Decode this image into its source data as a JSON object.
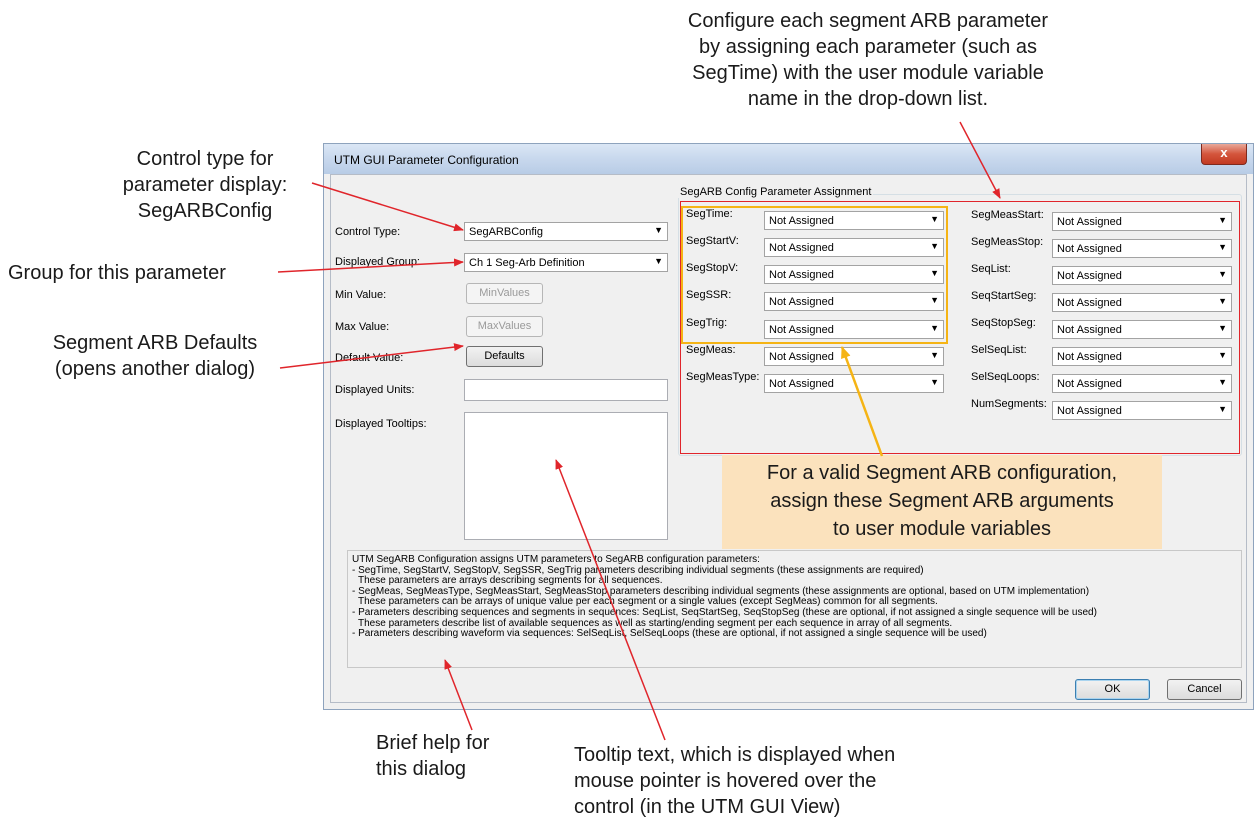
{
  "annotations": {
    "top_right": [
      "Configure each segment ARB parameter",
      "by assigning each parameter (such as",
      "SegTime) with the user module variable",
      "name in the drop-down list."
    ],
    "control_type": [
      "Control type for",
      "parameter display:",
      "SegARBConfig"
    ],
    "group": "Group for this parameter",
    "defaults": [
      "Segment ARB Defaults",
      "(opens another dialog)"
    ],
    "callout": [
      "For a valid Segment ARB configuration,",
      "assign these Segment ARB arguments",
      "to user module variables"
    ],
    "brief_help": [
      "Brief help for",
      "this dialog"
    ],
    "tooltip": [
      "Tooltip text, which is displayed when",
      "mouse pointer is hovered over the",
      "control (in the UTM GUI View)"
    ]
  },
  "dialog": {
    "title": "UTM GUI Parameter Configuration",
    "close_label": "x",
    "left": {
      "control_type_label": "Control Type:",
      "control_type_value": "SegARBConfig",
      "displayed_group_label": "Displayed Group:",
      "displayed_group_value": "Ch 1 Seg-Arb Definition",
      "min_value_label": "Min Value:",
      "min_value_button": "MinValues",
      "max_value_label": "Max Value:",
      "max_value_button": "MaxValues",
      "default_value_label": "Default Value:",
      "default_value_button": "Defaults",
      "displayed_units_label": "Displayed Units:",
      "displayed_tooltips_label": "Displayed Tooltips:"
    },
    "segarb": {
      "group_title": "SegARB Config Parameter Assignment",
      "left_col": [
        {
          "label": "SegTime:",
          "value": "Not Assigned"
        },
        {
          "label": "SegStartV:",
          "value": "Not Assigned"
        },
        {
          "label": "SegStopV:",
          "value": "Not Assigned"
        },
        {
          "label": "SegSSR:",
          "value": "Not Assigned"
        },
        {
          "label": "SegTrig:",
          "value": "Not Assigned"
        },
        {
          "label": "SegMeas:",
          "value": "Not Assigned"
        },
        {
          "label": "SegMeasType:",
          "value": "Not Assigned"
        }
      ],
      "right_col": [
        {
          "label": "SegMeasStart:",
          "value": "Not Assigned"
        },
        {
          "label": "SegMeasStop:",
          "value": "Not Assigned"
        },
        {
          "label": "SeqList:",
          "value": "Not Assigned"
        },
        {
          "label": "SeqStartSeg:",
          "value": "Not Assigned"
        },
        {
          "label": "SeqStopSeg:",
          "value": "Not Assigned"
        },
        {
          "label": "SelSeqList:",
          "value": "Not Assigned"
        },
        {
          "label": "SelSeqLoops:",
          "value": "Not Assigned"
        },
        {
          "label": "NumSegments:",
          "value": "Not Assigned"
        }
      ]
    },
    "help_lines": [
      "UTM SegARB Configuration assigns UTM parameters to SegARB configuration parameters:",
      "- SegTime, SegStartV, SegStopV, SegSSR, SegTrig parameters describing individual segments (these assignments are required)",
      "  These parameters are arrays describing segments for all sequences.",
      "- SegMeas, SegMeasType, SegMeasStart, SegMeasStop parameters describing individual segments (these assignments are optional, based on UTM implementation)",
      "  These parameters can be arrays of unique value per each segment or a single values (except SegMeas) common for all segments.",
      "- Parameters describing sequences and segments in sequences: SeqList, SeqStartSeg, SeqStopSeg (these are optional, if not assigned a single sequence will be used)",
      "  These parameters describe list of available sequences as well as starting/ending segment per each sequence in array of all segments.",
      "- Parameters describing waveform via sequences: SelSeqList, SelSeqLoops (these are optional, if not assigned a single sequence will be used)"
    ],
    "ok_label": "OK",
    "cancel_label": "Cancel"
  },
  "colors": {
    "annotation_red": "#e0252b",
    "annotation_yellow": "#f5b415",
    "callout_fill": "#fbe2bd"
  }
}
